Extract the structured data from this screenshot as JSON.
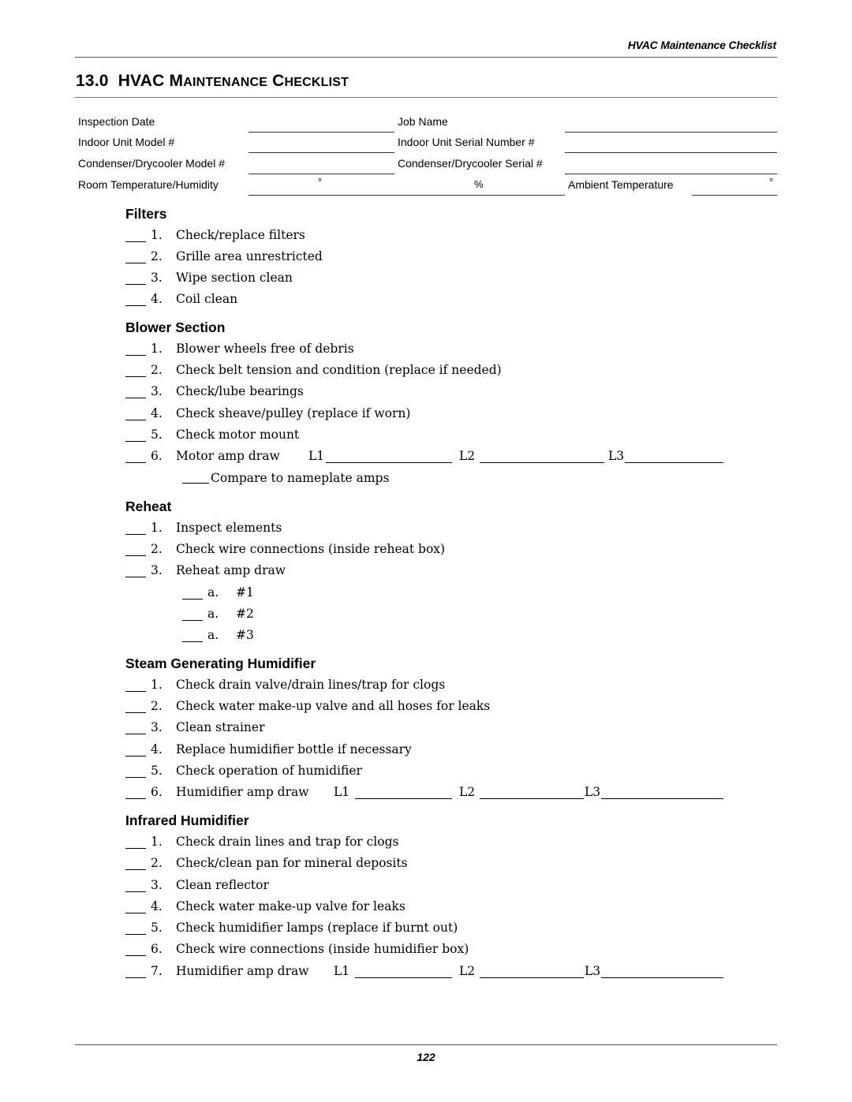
{
  "running_header": "HVAC Maintenance Checklist",
  "title": {
    "number": "13.0",
    "word1_cap": "HVAC",
    "word2_first": "M",
    "word2_rest": "AINTENANCE",
    "word3_first": "C",
    "word3_rest": "HECKLIST"
  },
  "header_form": {
    "inspection_date": "Inspection Date",
    "job_name": "Job Name",
    "indoor_unit_model": "Indoor Unit Model #",
    "indoor_unit_serial": "Indoor Unit Serial Number #",
    "condenser_model": "Condenser/Drycooler Model #",
    "condenser_serial": "Condenser/Drycooler Serial #",
    "room_temp_humidity": "Room Temperature/Humidity",
    "degree_symbol": "°",
    "percent_symbol": "%",
    "ambient_temperature": "Ambient Temperature"
  },
  "sections": {
    "filters": {
      "title": "Filters",
      "items": [
        {
          "num": "1.",
          "text": "Check/replace filters"
        },
        {
          "num": "2.",
          "text": "Grille area unrestricted"
        },
        {
          "num": "3.",
          "text": "Wipe section clean"
        },
        {
          "num": "4.",
          "text": "Coil clean"
        }
      ]
    },
    "blower": {
      "title": "Blower Section",
      "items": [
        {
          "num": "1.",
          "text": "Blower wheels free of debris"
        },
        {
          "num": "2.",
          "text": "Check belt tension and condition (replace if needed)"
        },
        {
          "num": "3.",
          "text": "Check/lube bearings"
        },
        {
          "num": "4.",
          "text": "Check sheave/pulley (replace if worn)"
        },
        {
          "num": "5.",
          "text": "Check motor mount"
        },
        {
          "num": "6.",
          "text": "Motor amp draw"
        }
      ],
      "l1": "L1",
      "l2": "L2",
      "l3": "L3",
      "compare": "Compare to nameplate amps"
    },
    "reheat": {
      "title": "Reheat",
      "items": [
        {
          "num": "1.",
          "text": "Inspect elements"
        },
        {
          "num": "2.",
          "text": "Check wire connections (inside reheat box)"
        },
        {
          "num": "3.",
          "text": "Reheat amp draw"
        }
      ],
      "sub_items": [
        {
          "letter": "a.",
          "text": "#1"
        },
        {
          "letter": "a.",
          "text": "#2"
        },
        {
          "letter": "a.",
          "text": "#3"
        }
      ]
    },
    "steam": {
      "title": "Steam Generating Humidifier",
      "items": [
        {
          "num": "1.",
          "text": "Check drain valve/drain lines/trap for clogs"
        },
        {
          "num": "2.",
          "text": "Check water make-up valve and all hoses for leaks"
        },
        {
          "num": "3.",
          "text": "Clean strainer"
        },
        {
          "num": "4.",
          "text": "Replace humidifier bottle if necessary"
        },
        {
          "num": "5.",
          "text": "Check operation of humidifier"
        },
        {
          "num": "6.",
          "text": "Humidifier amp draw"
        }
      ],
      "l1": "L1",
      "l2": "L2",
      "l3": "L3"
    },
    "infrared": {
      "title": "Infrared Humidifier",
      "items": [
        {
          "num": "1.",
          "text": "Check drain lines and trap for clogs"
        },
        {
          "num": "2.",
          "text": "Check/clean pan for mineral deposits"
        },
        {
          "num": "3.",
          "text": "Clean reflector"
        },
        {
          "num": "4.",
          "text": "Check water make-up valve for leaks"
        },
        {
          "num": "5.",
          "text": "Check humidifier lamps (replace if burnt out)"
        },
        {
          "num": "6.",
          "text": "Check wire connections (inside humidifier box)"
        },
        {
          "num": "7.",
          "text": "Humidifier amp draw"
        }
      ],
      "l1": "L1",
      "l2": "L2",
      "l3": "L3"
    }
  },
  "page_number": "122"
}
